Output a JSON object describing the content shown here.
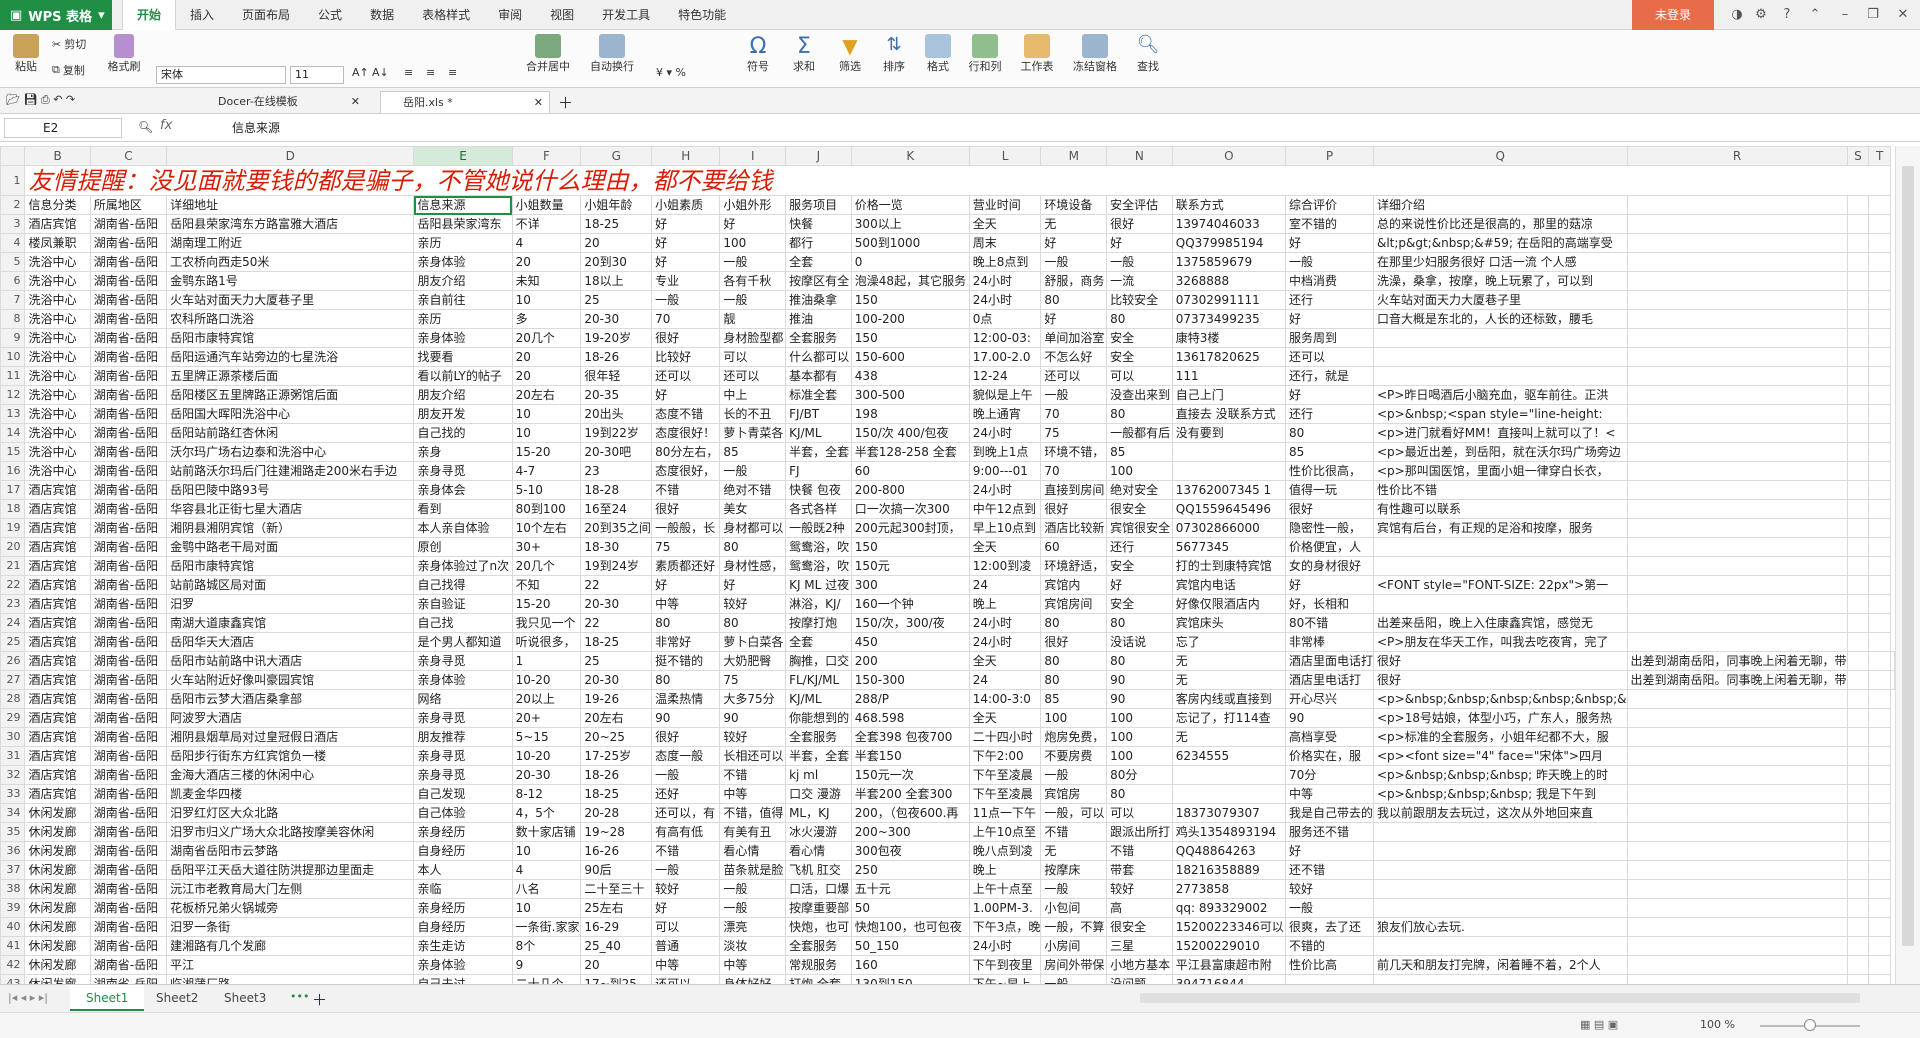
{
  "app": {
    "title": "WPS 表格",
    "login": "未登录",
    "help": "?"
  },
  "menu": [
    "开始",
    "插入",
    "页面布局",
    "公式",
    "数据",
    "表格样式",
    "审阅",
    "视图",
    "开发工具",
    "特色功能"
  ],
  "ribbon": {
    "paste": "粘贴",
    "cut": "剪切",
    "copy": "复制",
    "format_painter": "格式刷",
    "font": "宋体",
    "size": "11",
    "merge": "合并居中",
    "wrap": "自动换行",
    "symbol": "符号",
    "sum": "求和",
    "filter": "筛选",
    "sort": "排序",
    "format": "格式",
    "rowcol": "行和列",
    "sheet": "工作表",
    "freeze": "冻结窗格",
    "find": "查找"
  },
  "doc_tabs": [
    {
      "label": "Docer-在线模板",
      "active": false
    },
    {
      "label": "岳阳.xls *",
      "active": true
    }
  ],
  "formula": {
    "cell": "E2",
    "fx": "fx",
    "content": "信息来源"
  },
  "columns": [
    "B",
    "C",
    "D",
    "E",
    "F",
    "G",
    "H",
    "I",
    "J",
    "K",
    "L",
    "M",
    "N",
    "O",
    "P",
    "Q",
    "R",
    "S",
    "T"
  ],
  "warning": "友情提醒：没见面就要钱的都是骗子，不管她说什么理由，都不要给钱",
  "rows": [
    [
      "信息分类",
      "所属地区",
      "详细地址",
      "信息来源",
      "小姐数量",
      "小姐年龄",
      "小姐素质",
      "小姐外形",
      "服务项目",
      "价格一览",
      "营业时间",
      "环境设备",
      "安全评估",
      "联系方式",
      "综合评价",
      "详细介绍",
      "",
      "",
      ""
    ],
    [
      "酒店宾馆",
      "湖南省-岳阳",
      "岳阳县荣家湾东方路富雅大酒店",
      "岳阳县荣家湾东",
      "不详",
      "18-25",
      "好",
      "好",
      "快餐",
      "300以上",
      "全天",
      "无",
      "很好",
      "13974046033",
      "室不错的",
      "总的来说性价比还是很高的，那里的菇凉",
      "",
      "",
      ""
    ],
    [
      "楼凤兼职",
      "湖南省-岳阳",
      "湖南理工附近",
      "亲历",
      "4",
      "20",
      "好",
      "100",
      "都行",
      "500到1000",
      "周末",
      "好",
      "好",
      "QQ379985194",
      "好",
      "&lt;p&gt;&nbsp;&#59; 在岳阳的高端享受",
      "",
      "",
      ""
    ],
    [
      "洗浴中心",
      "湖南省-岳阳",
      "工农桥向西走50米",
      "亲身体验",
      "20",
      "20到30",
      "好",
      "一般",
      "全套",
      "0",
      "晚上8点到",
      "一般",
      "一般",
      "1375859679",
      "一般",
      "在那里少妇服务很好  口活一流  个人感",
      "",
      "",
      ""
    ],
    [
      "洗浴中心",
      "湖南省-岳阳",
      "金鹗东路1号",
      "朋友介绍",
      "未知",
      "18以上",
      "专业",
      "各有千秋",
      "按摩区有全",
      "泡澡48起，其它服务",
      "24小时",
      "舒服，商务",
      "一流",
      "3268888",
      "中档消费",
      "洗澡，桑拿，按摩，晚上玩累了，可以到",
      "",
      "",
      ""
    ],
    [
      "洗浴中心",
      "湖南省-岳阳",
      "火车站对面天力大厦巷子里",
      "亲自前往",
      "10",
      "25",
      "一般",
      "一般",
      "推油桑拿",
      "150",
      "24小时",
      "80",
      "比较安全",
      "07302991111",
      "还行",
      "火车站对面天力大厦巷子里",
      "",
      "",
      ""
    ],
    [
      "洗浴中心",
      "湖南省-岳阳",
      "农科所路口洗浴",
      "亲历",
      "多",
      "20-30",
      "70",
      "靓",
      "推油",
      "100-200",
      "0点",
      "好",
      "80",
      "07373499235",
      "好",
      "口音大概是东北的，人长的还标致，腰毛",
      "",
      "",
      ""
    ],
    [
      "洗浴中心",
      "湖南省-岳阳",
      "岳阳市康特宾馆",
      "亲身体验",
      "20几个",
      "19-20岁",
      "很好",
      "身材脸型都",
      "全套服务",
      "150",
      "12:00-03:",
      "单间加浴室",
      "安全",
      "康特3楼",
      "服务周到",
      "",
      "",
      "",
      ""
    ],
    [
      "洗浴中心",
      "湖南省-岳阳",
      "岳阳运通汽车站旁边的七星洗浴",
      "找要看",
      "20",
      "18-26",
      "比较好",
      "可以",
      "什么都可以",
      "150-600",
      "17.00-2.0",
      "不怎么好",
      "安全",
      "13617820625",
      "还可以",
      "",
      "",
      "",
      ""
    ],
    [
      "洗浴中心",
      "湖南省-岳阳",
      "五里牌正源茶楼后面",
      "看以前LY的帖子",
      "20",
      "很年轻",
      "还可以",
      "还可以",
      "基本都有",
      "438",
      "12-24",
      "还可以",
      "可以",
      "111",
      "还行，就是",
      "",
      "",
      "",
      ""
    ],
    [
      "洗浴中心",
      "湖南省-岳阳",
      "岳阳楼区五里牌路正源粥馆后面",
      "朋友介绍",
      "20左右",
      "20-35",
      "好",
      "中上",
      "标准全套",
      "300-500",
      "貌似是上午",
      "一般",
      "没查出来到",
      "自己上门",
      "好",
      "<P>昨日喝酒后小脑充血，驱车前往。正洪",
      "",
      "",
      ""
    ],
    [
      "洗浴中心",
      "湖南省-岳阳",
      "岳阳国大晖阳洗浴中心",
      "朋友开发",
      "10",
      "20出头",
      "态度不错",
      "长的不丑",
      "FJ/BT",
      "198",
      "晚上通宵",
      "70",
      "80",
      "直接去 没联系方式",
      "还行",
      "<p>&nbsp;<span style=\"line-height:",
      "",
      "",
      ""
    ],
    [
      "洗浴中心",
      "湖南省-岳阳",
      "岳阳站前路红杏休闲",
      "自己找的",
      "10",
      "19到22岁",
      "态度很好！",
      "萝卜青菜各",
      "KJ/ML",
      "150/次   400/包夜",
      "24小时",
      "75",
      "一般都有后",
      "没有要到",
      "80",
      "<p>进门就看好MM！直接叫上就可以了！<",
      "",
      "",
      ""
    ],
    [
      "洗浴中心",
      "湖南省-岳阳",
      "沃尔玛广场右边泰和洗浴中心",
      "亲身",
      "15-20",
      "20-30吧",
      "80分左右，",
      "85",
      "半套，全套",
      "半套128-258 全套",
      "到晚上1点",
      "环境不错，",
      "85",
      "",
      "85",
      "<p>最近出差，到岳阳，就在沃尔玛广场旁边",
      "",
      "",
      ""
    ],
    [
      "洗浴中心",
      "湖南省-岳阳",
      "站前路沃尔玛后门往建湘路走200米右手边",
      "亲身寻觅",
      "4-7",
      "23",
      "态度很好，",
      "一般",
      "FJ",
      "60",
      "9:00---01",
      "70",
      "100",
      "",
      "性价比很高，",
      "<p>那叫国医馆，里面小姐一律穿白长衣，",
      "",
      "",
      ""
    ],
    [
      "酒店宾馆",
      "湖南省-岳阳",
      "岳阳巴陵中路93号",
      "亲身体会",
      "5-10",
      "18-28",
      "不错",
      "绝对不错",
      "快餐 包夜",
      "200-800",
      "24小时",
      "直接到房间",
      "绝对安全",
      "13762007345 1",
      "值得一玩",
      "性价比不错",
      "",
      "",
      ""
    ],
    [
      "酒店宾馆",
      "湖南省-岳阳",
      "华容县北正街七星大酒店",
      "看到",
      "80到100",
      "16至24",
      "很好",
      "美女",
      "各式各样",
      "口一次搞一次300",
      "中午12点到",
      "很好",
      "很安全",
      "QQ1559645496",
      "很好",
      "有性趣可以联系",
      "",
      "",
      ""
    ],
    [
      "酒店宾馆",
      "湖南省-岳阳",
      "湘阴县湘阴宾馆（新）",
      "本人亲自体验",
      "10个左右",
      "20到35之间",
      "一般般，长",
      "身材都可以",
      "一般既2种",
      "200元起300封顶，",
      "早上10点到",
      "酒店比较新",
      "宾馆很安全",
      "07302866000",
      "隐密性一般，",
      "宾馆有后台，有正规的足浴和按摩，服务",
      "",
      "",
      ""
    ],
    [
      "酒店宾馆",
      "湖南省-岳阳",
      "金鹗中路老干局对面",
      "原创",
      "30+",
      "18-30",
      "75",
      "80",
      "鸳鸯浴，吹",
      "150",
      "全天",
      "60",
      "还行",
      "5677345",
      "价格便宜，人",
      "",
      "",
      "",
      ""
    ],
    [
      "酒店宾馆",
      "湖南省-岳阳",
      "岳阳市康特宾馆",
      "亲身体验过了n次",
      "20几个",
      "19到24岁",
      "素质都还好",
      "身材性感，",
      "鸳鸯浴，吹",
      "150元",
      "12:00到凌",
      "环境舒适，",
      "安全",
      "打的士到康特宾馆",
      "女的身材很好",
      "",
      "",
      "",
      ""
    ],
    [
      "酒店宾馆",
      "湖南省-岳阳",
      "站前路城区局对面",
      "自己找得",
      "不知",
      "22",
      "好",
      "好",
      "KJ ML 过夜",
      "300",
      "24",
      "宾馆内",
      "好",
      "宾馆内电话",
      "好",
      "<FONT style=\"FONT-SIZE: 22px\">第一",
      "",
      "",
      ""
    ],
    [
      "酒店宾馆",
      "湖南省-岳阳",
      "汨罗",
      "亲自验证",
      "15-20",
      "20-30",
      "中等",
      "较好",
      "淋浴，KJ/",
      "160一个钟",
      "晚上",
      "宾馆房间",
      "安全",
      "好像仅限酒店内",
      "好，长相和",
      "",
      "",
      "",
      ""
    ],
    [
      "酒店宾馆",
      "湖南省-岳阳",
      "南湖大道康鑫宾馆",
      "自己找",
      "我只见一个",
      "22",
      "80",
      "80",
      "按摩打炮",
      "150/次，300/夜",
      "24小时",
      "80",
      "80",
      "宾馆床头",
      "80不错",
      "出差来岳阳，晚上入住康鑫宾馆，感觉无",
      "",
      "",
      ""
    ],
    [
      "酒店宾馆",
      "湖南省-岳阳",
      "岳阳华天大酒店",
      "是个男人都知道",
      "听说很多，",
      "18-25",
      "非常好",
      "萝卜白菜各",
      "全套",
      "450",
      "24小时",
      "很好",
      "没话说",
      "忘了",
      "非常棒",
      "<P>朋友在华天工作，叫我去吃夜宵，完了",
      "",
      "",
      ""
    ],
    [
      "酒店宾馆",
      "湖南省-岳阳",
      "岳阳市站前路中讯大酒店",
      "亲身寻觅",
      "1",
      "25",
      "挺不错的",
      "大奶肥臀",
      "胸推，口交",
      "200",
      "全天",
      "80",
      "80",
      "无",
      "酒店里面电话打",
      "很好",
      "出差到湖南岳阳，同事晚上闲着无聊，带",
      "",
      "",
      ""
    ],
    [
      "酒店宾馆",
      "湖南省-岳阳",
      "火车站附近好像叫豪园宾馆",
      "亲身体验",
      "10-20",
      "20-30",
      "80",
      "75",
      "FL/KJ/ML",
      "150-300",
      "24",
      "80",
      "90",
      "无",
      "酒店里电话打",
      "很好",
      "出差到湖南岳阳。同事晚上闲着无聊，带",
      "",
      "",
      ""
    ],
    [
      "酒店宾馆",
      "湖南省-岳阳",
      "岳阳市云梦大酒店桑拿部",
      "网络",
      "20以上",
      "19-26",
      "温柔热情",
      "大多75分",
      "KJ/ML",
      "288/P",
      "14:00-3:0",
      "85",
      "90",
      "客房内线或直接到",
      "开心尽兴",
      "<p>&nbsp;&nbsp;&nbsp;&nbsp;&nbsp;&",
      "",
      "",
      ""
    ],
    [
      "酒店宾馆",
      "湖南省-岳阳",
      "阿波罗大酒店",
      "亲身寻觅",
      "20+",
      "20左右",
      "90",
      "90",
      "你能想到的",
      "468.598",
      "全天",
      "100",
      "100",
      "忘记了，打114查",
      "90",
      "<p>18号姑娘，体型小巧，广东人，服务热",
      "",
      "",
      ""
    ],
    [
      "酒店宾馆",
      "湖南省-岳阳",
      "湘阴县烟草局对过皇冠假日酒店",
      "朋友推荐",
      "5~15",
      "20~25",
      "很好",
      "较好",
      "全套服务",
      "全套398  包夜700",
      "二十四小时",
      "炮房免费，",
      "100",
      "无",
      "高档享受",
      "<p>标准的全套服务，小姐年纪都不大，服",
      "",
      "",
      ""
    ],
    [
      "酒店宾馆",
      "湖南省-岳阳",
      "岳阳步行街东方红宾馆负一楼",
      "亲身寻觅",
      "10-20",
      "17-25岁",
      "态度一般",
      "长相还可以",
      "半套，全套",
      "半套150",
      "下午2:00",
      "不要房费",
      "100",
      "6234555",
      "价格实在，服",
      "<p><font size=\"4\" face=\"宋体\">四月",
      "",
      "",
      ""
    ],
    [
      "酒店宾馆",
      "湖南省-岳阳",
      "金海大酒店三楼的休闲中心",
      "亲身寻觅",
      "20-30",
      "18-26",
      "一般",
      "不错",
      "kj ml",
      "150元一次",
      "下午至凌晨",
      "一般",
      "80分",
      "",
      "70分",
      "<p>&nbsp;&nbsp;&nbsp; 昨天晚上的时",
      "",
      "",
      ""
    ],
    [
      "酒店宾馆",
      "湖南省-岳阳",
      "凯麦金华四楼",
      "自己发现",
      "8-12",
      "18-25",
      "还好",
      "中等",
      "口交 漫游",
      "半套200 全套300",
      "下午至凌晨",
      "宾馆房",
      "80",
      "",
      "中等",
      "<p>&nbsp;&nbsp;&nbsp; 我是下午到",
      "",
      "",
      ""
    ],
    [
      "休闲发廊",
      "湖南省-岳阳",
      "汨罗红灯区大众北路",
      "自己体验",
      "4，5个",
      "20-28",
      "还可以，有",
      "不错，值得",
      "ML，KJ",
      "200，（包夜600.再",
      "11点一下午",
      "一般，可以",
      "可以",
      "18373079307",
      "我是自己带去的",
      "我以前跟朋友去玩过，这次从外地回来直",
      "",
      "",
      ""
    ],
    [
      "休闲发廊",
      "湖南省-岳阳",
      "汨罗市归义广场大众北路按摩美容休闲",
      "亲身经历",
      "数十家店铺",
      "19~28",
      "有高有低",
      "有美有丑",
      "冰火漫游",
      "200~300",
      "上午10点至",
      "不错",
      "跟派出所打",
      "鸡头1354893194",
      "服务还不错",
      "",
      "",
      "",
      ""
    ],
    [
      "休闲发廊",
      "湖南省-岳阳",
      "湖南省岳阳市云梦路",
      "自身经历",
      "10",
      "16-26",
      "不错",
      "看心情",
      "看心情",
      "300包夜",
      "晚八点到凌",
      "无",
      "不错",
      "QQ48864263",
      "好",
      "",
      "",
      "",
      ""
    ],
    [
      "休闲发廊",
      "湖南省-岳阳",
      "岳阳平江天岳大道往防洪提那边里面走",
      "本人",
      "4",
      "90后",
      "一般",
      "苗条就是脸",
      "飞机 肛交",
      "250",
      "晚上",
      "按摩床",
      "带套",
      "18216358889",
      "还不错",
      "",
      "",
      "",
      ""
    ],
    [
      "休闲发廊",
      "湖南省-岳阳",
      "沅江市老教育局大门左侧",
      "亲临",
      "八名",
      "二十至三十",
      "较好",
      "一般",
      "口活，口爆",
      "五十元",
      "上午十点至",
      "一般",
      "较好",
      "2773858",
      "较好",
      "",
      "",
      "",
      ""
    ],
    [
      "休闲发廊",
      "湖南省-岳阳",
      "花板桥兄弟火锅城旁",
      "亲身经历",
      "10",
      "25左右",
      "好",
      "一般",
      "按摩重要部",
      "50",
      "1.00PM-3.",
      "小包间",
      "高",
      "qq: 893329002",
      "一般",
      "",
      "",
      "",
      ""
    ],
    [
      "休闲发廊",
      "湖南省-岳阳",
      "汨罗一条街",
      "自身经历",
      "一条街.家家",
      "16-29",
      "可以",
      "漂亮",
      "快炮，也可",
      "快炮100，也可包夜",
      "下午3点，晚",
      "一般，不算",
      "很安全",
      "15200223346可以",
      "很爽，去了还",
      "狼友们放心去玩.",
      "",
      "",
      ""
    ],
    [
      "休闲发廊",
      "湖南省-岳阳",
      "建湘路有几个发廊",
      "亲生走访",
      "8个",
      "25_40",
      "普通",
      "淡妆",
      "全套服务",
      "50_150",
      "24小时",
      "小房间",
      "三星",
      "15200229010",
      "不错的",
      "",
      "",
      "",
      ""
    ],
    [
      "休闲发廊",
      "湖南省-岳阳",
      "平江",
      "亲身体验",
      "9",
      "20",
      "中等",
      "中等",
      "常规服务",
      "160",
      "下午到夜里",
      "房间外带保",
      "小地方基本",
      "平江县富康超市附",
      "性价比高",
      "前几天和朋友打完牌，闲着睡不着，2个人",
      "",
      "",
      ""
    ],
    [
      "休闲发廊",
      "湖南省-岳阳",
      "临湘蒲厂路",
      "自己去过",
      "二十几个",
      "17~到25",
      "还可以",
      "身体好好",
      "打炮 全套",
      "130到150",
      "下午~早上",
      "一般",
      "没问题",
      "394716844",
      "",
      "",
      "",
      "",
      ""
    ]
  ],
  "sheets": [
    {
      "label": "Sheet1",
      "active": true
    },
    {
      "label": "Sheet2",
      "active": false
    },
    {
      "label": "Sheet3",
      "active": false
    }
  ],
  "status": {
    "zoom": "100 %",
    "zoom_fraction": 0.5
  }
}
